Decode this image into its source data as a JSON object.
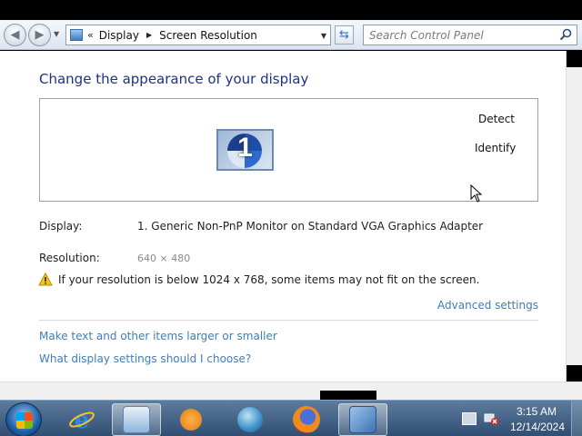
{
  "navbar": {
    "breadcrumbs": [
      "Display",
      "Screen Resolution"
    ],
    "search_placeholder": "Search Control Panel"
  },
  "main": {
    "title": "Change the appearance of your display",
    "monitor_number": "1",
    "detect_label": "Detect",
    "identify_label": "Identify",
    "display_label": "Display:",
    "display_value": "1. Generic Non-PnP Monitor on Standard VGA Graphics Adapter",
    "resolution_label": "Resolution:",
    "resolution_value": "640 × 480",
    "warning_text": "If your resolution is below 1024 x 768, some items may not fit on the screen.",
    "advanced_link": "Advanced settings",
    "links": [
      "Make text and other items larger or smaller",
      "What display settings should I choose?"
    ]
  },
  "taskbar": {
    "apps": [
      {
        "icon": "internet-explorer-icon"
      },
      {
        "icon": "control-panel-icon",
        "active": true
      },
      {
        "icon": "media-player-icon"
      },
      {
        "icon": "network-globe-icon"
      },
      {
        "icon": "firefox-icon"
      },
      {
        "icon": "display-settings-icon",
        "active": true
      }
    ],
    "clock_time": "3:15 AM",
    "clock_date": "12/14/2024"
  }
}
